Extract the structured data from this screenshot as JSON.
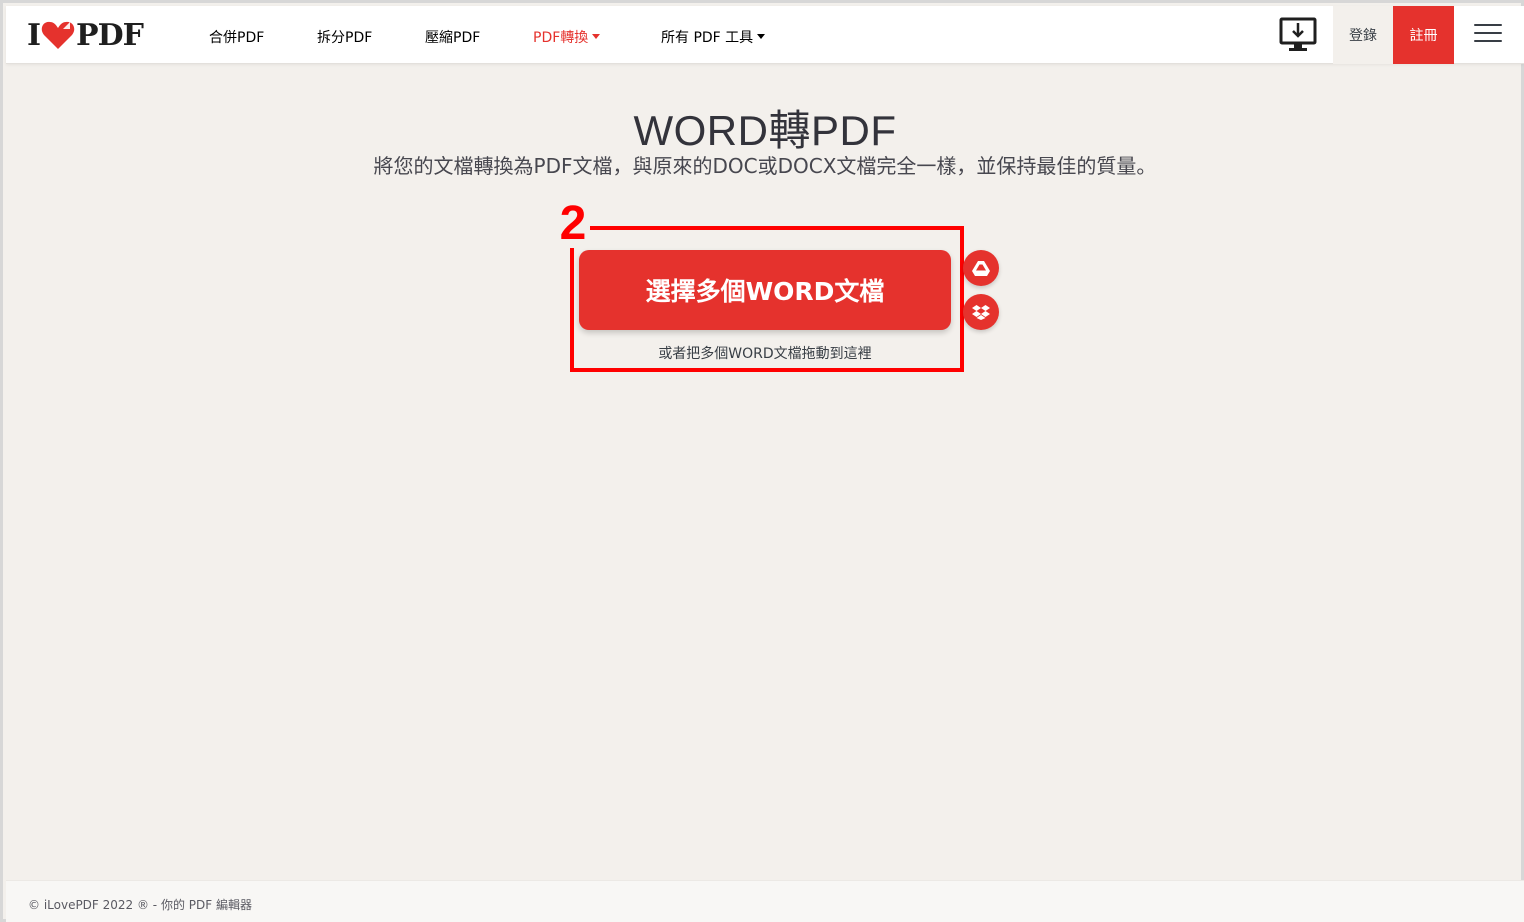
{
  "header": {
    "logo": {
      "left": "I",
      "right": "PDF"
    },
    "nav": [
      {
        "label": "合併PDF",
        "dropdown": false,
        "active": false
      },
      {
        "label": "拆分PDF",
        "dropdown": false,
        "active": false
      },
      {
        "label": "壓縮PDF",
        "dropdown": false,
        "active": false
      },
      {
        "label": "PDF轉換",
        "dropdown": true,
        "active": true
      },
      {
        "label": "所有 PDF 工具",
        "dropdown": true,
        "active": false
      }
    ],
    "desktop_icon": "desktop-download-icon",
    "login_label": "登錄",
    "signup_label": "註冊",
    "menu_icon": "hamburger-menu-icon"
  },
  "main": {
    "title": "WORD轉PDF",
    "subtitle": "將您的文檔轉換為PDF文檔，與原來的DOC或DOCX文檔完全一樣，並保持最佳的質量。",
    "upload_button": "選擇多個WORD文檔",
    "drop_hint": "或者把多個WORD文檔拖動到這裡",
    "cloud_buttons": [
      "google-drive-icon",
      "dropbox-icon"
    ]
  },
  "annotation": {
    "number": "2"
  },
  "footer": {
    "text": "© iLovePDF 2022 ® - 你的 PDF 編輯器"
  },
  "colors": {
    "brand_red": "#e5322d",
    "annotation_red": "#ff0000",
    "background": "#f3f0ec",
    "text": "#33333b"
  }
}
